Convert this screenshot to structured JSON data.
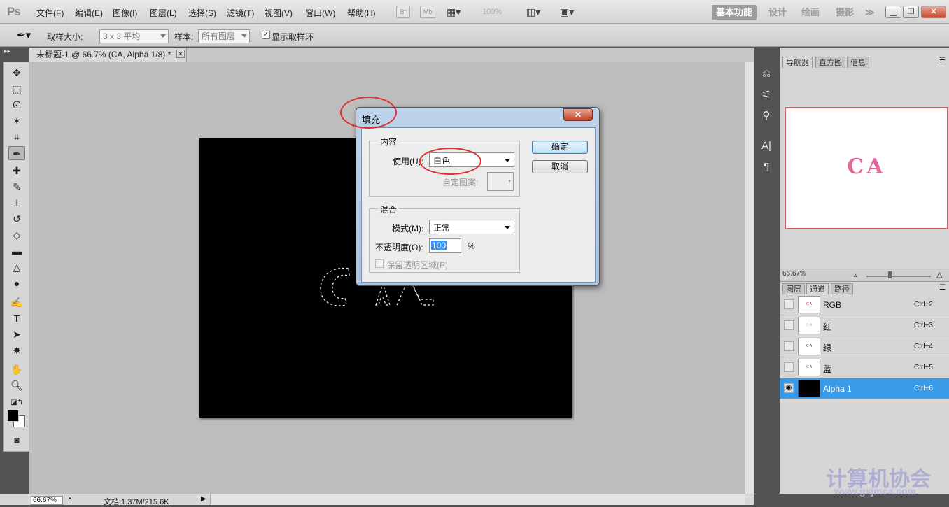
{
  "app": {
    "logo": "Ps",
    "menu": [
      "文件(F)",
      "编辑(E)",
      "图像(I)",
      "图层(L)",
      "选择(S)",
      "滤镜(T)",
      "视图(V)",
      "窗口(W)",
      "帮助(H)"
    ],
    "bridge_btn": "Br",
    "minibridge_btn": "Mb",
    "zoom_select": "100%",
    "workspaces": [
      "基本功能",
      "设计",
      "绘画",
      "摄影"
    ],
    "ws_more": "≫"
  },
  "options": {
    "sample_size_label": "取样大小:",
    "sample_size_value": "3 x 3 平均",
    "sample_label": "样本:",
    "sample_value": "所有图层",
    "show_ring_label": "显示取样环",
    "show_ring_checked": true
  },
  "document": {
    "tab_title": "未标题-1 @ 66.7% (CA, Alpha 1/8) *",
    "tab_close": "✕",
    "zoom": "66.67%",
    "doc_info": "文档:1.37M/215.6K"
  },
  "navigator": {
    "tabs": [
      "导航器",
      "直方图",
      "信息"
    ],
    "preview_text": "CA",
    "zoom": "66.67%",
    "preview_color": "#e0679a"
  },
  "channels": {
    "tabs": [
      "图层",
      "通道",
      "路径"
    ],
    "rows": [
      {
        "name": "RGB",
        "shortcut": "Ctrl+2",
        "thumb": "C A"
      },
      {
        "name": "红",
        "shortcut": "Ctrl+3",
        "thumb": "C A"
      },
      {
        "name": "绿",
        "shortcut": "Ctrl+4",
        "thumb": "C A"
      },
      {
        "name": "蓝",
        "shortcut": "Ctrl+5",
        "thumb": "C A"
      },
      {
        "name": "Alpha 1",
        "shortcut": "Ctrl+6",
        "thumb": ""
      }
    ],
    "selected_color": "#3a9ce8"
  },
  "dialog": {
    "title": "填充",
    "close": "✕",
    "content_legend": "内容",
    "use_label": "使用(U):",
    "use_value": "白色",
    "custom_pattern_label": "自定图案:",
    "blend_legend": "混合",
    "mode_label": "模式(M):",
    "mode_value": "正常",
    "opacity_label": "不透明度(O):",
    "opacity_value": "100",
    "opacity_unit": "%",
    "preserve_label": "保留透明区域(P)",
    "ok": "确定",
    "cancel": "取消"
  },
  "watermark": {
    "text": "计算机协会",
    "url": "www.gxjmca.com"
  }
}
